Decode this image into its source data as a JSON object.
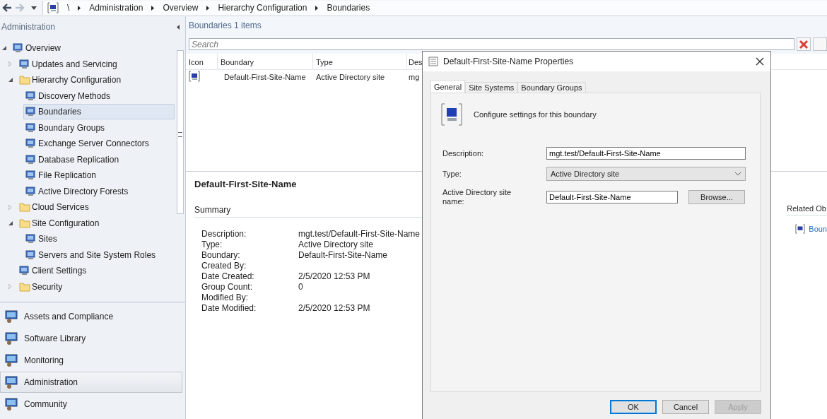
{
  "toolbar": {
    "breadcrumb": [
      "\\",
      "Administration",
      "Overview",
      "Hierarchy Configuration",
      "Boundaries"
    ]
  },
  "navigation": {
    "title": "Administration",
    "tree": [
      {
        "label": "Overview",
        "kind": "item",
        "expanded": true,
        "selected": false,
        "children": [
          {
            "label": "Updates and Servicing",
            "kind": "item",
            "expanded": false,
            "selected": false
          },
          {
            "label": "Hierarchy Configuration",
            "kind": "folder",
            "expanded": true,
            "selected": false,
            "children": [
              {
                "label": "Discovery Methods",
                "kind": "item",
                "selected": false
              },
              {
                "label": "Boundaries",
                "kind": "item",
                "selected": true
              },
              {
                "label": "Boundary Groups",
                "kind": "item",
                "selected": false
              },
              {
                "label": "Exchange Server Connectors",
                "kind": "item",
                "selected": false
              },
              {
                "label": "Database Replication",
                "kind": "item",
                "selected": false
              },
              {
                "label": "File Replication",
                "kind": "item",
                "selected": false
              },
              {
                "label": "Active Directory Forests",
                "kind": "item",
                "selected": false
              }
            ]
          },
          {
            "label": "Cloud Services",
            "kind": "folder",
            "expanded": false,
            "selected": false
          },
          {
            "label": "Site Configuration",
            "kind": "folder",
            "expanded": true,
            "selected": false,
            "children": [
              {
                "label": "Sites",
                "kind": "item",
                "selected": false
              },
              {
                "label": "Servers and Site System Roles",
                "kind": "item",
                "selected": false
              }
            ]
          },
          {
            "label": "Client Settings",
            "kind": "item",
            "selected": false
          },
          {
            "label": "Security",
            "kind": "folder",
            "expanded": false,
            "selected": false
          }
        ]
      }
    ],
    "workspaces": [
      {
        "label": "Assets and Compliance",
        "selected": false
      },
      {
        "label": "Software Library",
        "selected": false
      },
      {
        "label": "Monitoring",
        "selected": false
      },
      {
        "label": "Administration",
        "selected": true
      },
      {
        "label": "Community",
        "selected": false
      }
    ]
  },
  "list": {
    "title": "Boundaries 1 items",
    "search": {
      "placeholder": "Search"
    },
    "columns": [
      "Icon",
      "Boundary",
      "Type",
      "Des"
    ],
    "rows": [
      {
        "cells": [
          "",
          "Default-First-Site-Name",
          "Active Directory site",
          "mg"
        ]
      }
    ]
  },
  "details": {
    "title": "Default-First-Site-Name",
    "summary_heading": "Summary",
    "fields": [
      {
        "label": "Description:",
        "value": "mgt.test/Default-First-Site-Name"
      },
      {
        "label": "Type:",
        "value": "Active Directory site"
      },
      {
        "label": "Boundary:",
        "value": "Default-First-Site-Name"
      },
      {
        "label": "Created By:"
      },
      {
        "label": "Date Created:",
        "value": "2/5/2020 12:53 PM"
      },
      {
        "label": "Group Count:",
        "value": "0"
      },
      {
        "label": "Modified By:"
      },
      {
        "label": "Date Modified:",
        "value": "2/5/2020 12:53 PM"
      }
    ],
    "related_heading": "Related Ob",
    "related_links": [
      "Boun"
    ]
  },
  "dialog": {
    "title": "Default-First-Site-Name Properties",
    "tabs": [
      {
        "label": "General",
        "selected": true
      },
      {
        "label": "Site Systems",
        "selected": false
      },
      {
        "label": "Boundary Groups",
        "selected": false
      }
    ],
    "heading": "Configure settings for this boundary",
    "fields": [
      {
        "kind": "text",
        "label": "Description:",
        "value": "mgt.test/Default-First-Site-Name"
      },
      {
        "kind": "select",
        "label": "Type:",
        "value": "Active Directory site"
      },
      {
        "kind": "browse",
        "label": "Active Directory site name:",
        "value": "Default-First-Site-Name",
        "button": "Browse..."
      }
    ],
    "buttons": [
      {
        "label": "OK",
        "default": true,
        "disabled": false
      },
      {
        "label": "Cancel",
        "default": false,
        "disabled": false
      },
      {
        "label": "Apply",
        "default": false,
        "disabled": true
      }
    ]
  }
}
